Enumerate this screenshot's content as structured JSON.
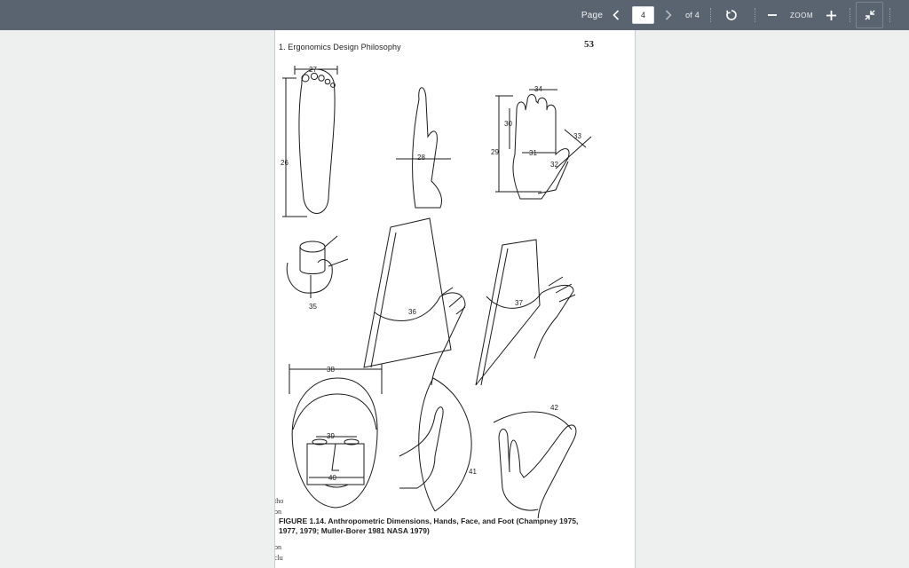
{
  "toolbar": {
    "page_label": "Page",
    "current_page": "4",
    "of_label": "of 4",
    "zoom_label": "ZOOM",
    "icons": {
      "prev": "chevron-left-icon",
      "next": "chevron-right-icon",
      "rotate": "rotate-icon",
      "zoom_out": "minus-icon",
      "zoom_in": "plus-icon",
      "fit": "collapse-icon"
    },
    "colors": {
      "bar": "#5a6470",
      "text": "#f2f4f6"
    }
  },
  "document": {
    "running_head": "1. Ergonomics Design Philosophy",
    "page_number": "53",
    "caption_line1": "FIGURE 1.14. Anthropometric Dimensions, Hands, Face, and Foot (Champney 1975,",
    "caption_line2": "1977, 1979; Muller-Borer 1981 NASA 1979)",
    "labels": {
      "d26": "26",
      "d27": "27",
      "d28": "28",
      "d29": "29",
      "d30": "30",
      "d31": "31",
      "d32": "32",
      "d33": "33",
      "d34": "34",
      "d35": "35",
      "d36": "36",
      "d37": "37",
      "d38": "38",
      "d39": "39",
      "d40": "40",
      "d41": "41",
      "d42": "42"
    },
    "margin_fragments": [
      "tho",
      "on",
      "on",
      "clu"
    ]
  }
}
